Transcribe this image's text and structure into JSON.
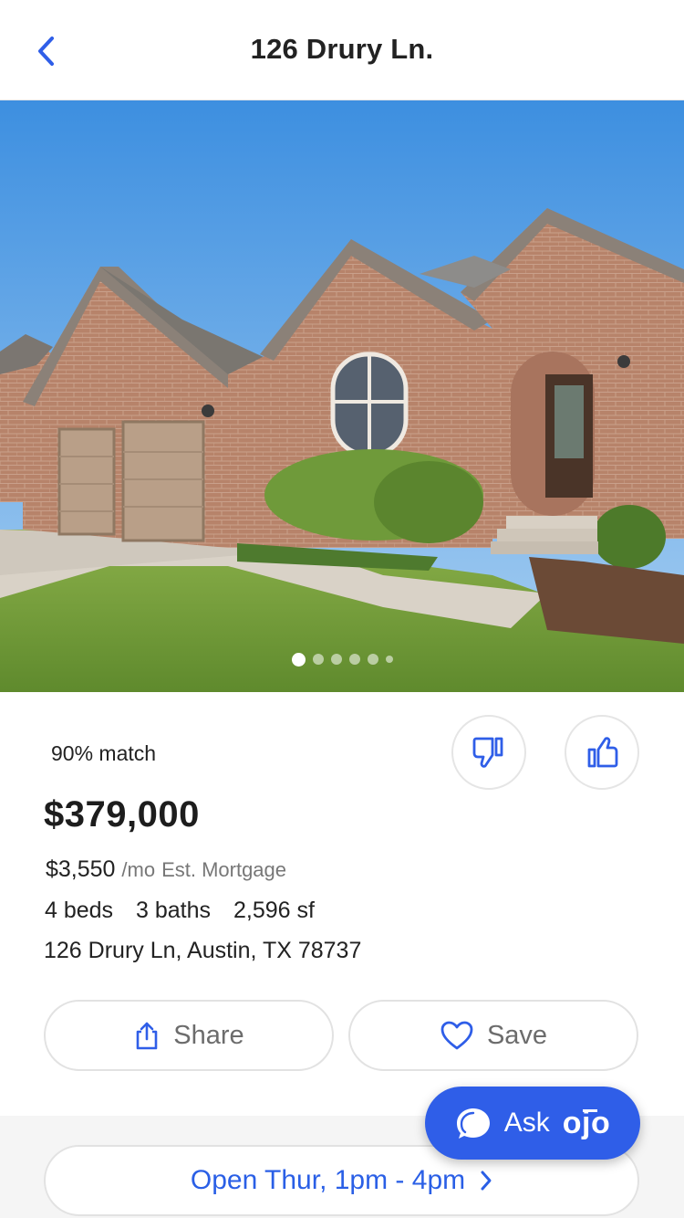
{
  "header": {
    "title": "126 Drury Ln.",
    "back_icon": "chevron-left-icon"
  },
  "gallery": {
    "photo_count": 6,
    "active_index": 0
  },
  "listing": {
    "match": "90% match",
    "price": "$379,000",
    "mortgage_amount": "$3,550",
    "mortgage_period": "/mo",
    "mortgage_label": "Est. Mortgage",
    "beds": "4 beds",
    "baths": "3 baths",
    "sqft": "2,596 sf",
    "address": "126 Drury Ln, Austin, TX 78737"
  },
  "rating": {
    "dislike_icon": "thumbs-down-icon",
    "like_icon": "thumbs-up-icon"
  },
  "actions": {
    "share_label": "Share",
    "save_label": "Save"
  },
  "open_house": {
    "label": "Open Thur, 1pm - 4pm"
  },
  "assistant": {
    "label": "Ask",
    "brand": "ojo"
  },
  "colors": {
    "accent": "#2f5ee8",
    "link": "#2a5fe6"
  }
}
